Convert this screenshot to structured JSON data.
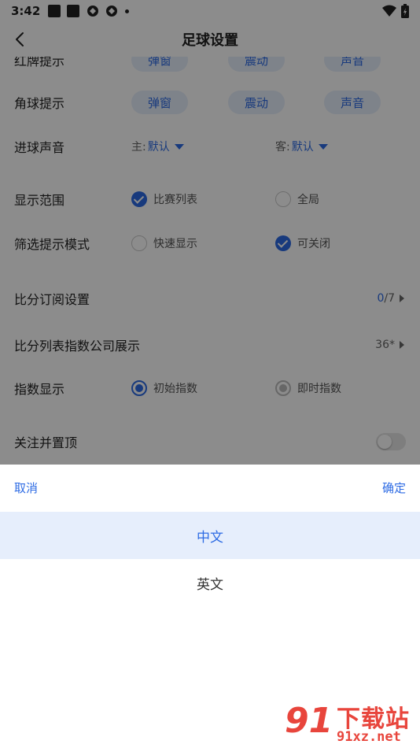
{
  "status_bar": {
    "time": "3:42"
  },
  "header": {
    "title": "足球设置"
  },
  "settings": {
    "partial_row": {
      "label": "红牌提示",
      "options": [
        "弹窗",
        "震动",
        "声音"
      ]
    },
    "corner": {
      "label": "角球提示",
      "options": [
        "弹窗",
        "震动",
        "声音"
      ]
    },
    "goal_sound": {
      "label": "进球声音",
      "home_prefix": "主:",
      "home_value": "默认",
      "away_prefix": "客:",
      "away_value": "默认"
    },
    "display_range": {
      "label": "显示范围",
      "opt1": "比赛列表",
      "opt2": "全局"
    },
    "filter_mode": {
      "label": "筛选提示模式",
      "opt1": "快速显示",
      "opt2": "可关闭"
    },
    "score_sub": {
      "label": "比分订阅设置",
      "value_current": "0",
      "value_total": "/7"
    },
    "index_company": {
      "label": "比分列表指数公司展示",
      "value": "36*"
    },
    "index_display": {
      "label": "指数显示",
      "opt1": "初始指数",
      "opt2": "即时指数"
    },
    "follow_pin": {
      "label": "关注并置顶"
    }
  },
  "sheet": {
    "cancel": "取消",
    "confirm": "确定",
    "options": [
      "中文",
      "英文"
    ]
  },
  "watermark": {
    "text": "下载站",
    "url": "91xz.net"
  },
  "colors": {
    "accent": "#2d6be4",
    "accent_light": "#e6eefc",
    "watermark": "#e8453c"
  }
}
